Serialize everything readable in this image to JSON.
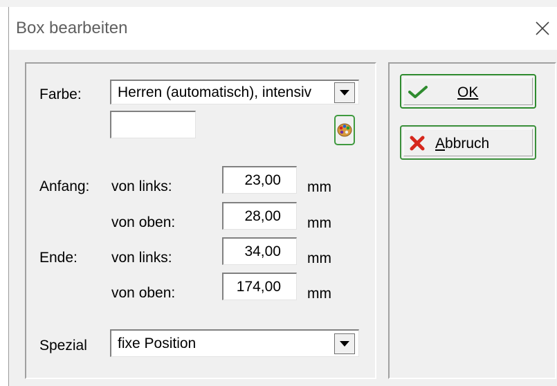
{
  "dialog": {
    "title": "Box bearbeiten",
    "close_icon": "close-icon"
  },
  "farbe": {
    "label": "Farbe:",
    "selected": "Herren (automatisch), intensiv",
    "color_field_value": "",
    "palette_icon": "palette-icon"
  },
  "anfang": {
    "label": "Anfang:",
    "left_label": "von links:",
    "left_value": "23,00",
    "left_unit": "mm",
    "top_label": "von oben:",
    "top_value": "28,00",
    "top_unit": "mm"
  },
  "ende": {
    "label": "Ende:",
    "left_label": "von links:",
    "left_value": "34,00",
    "left_unit": "mm",
    "top_label": "von oben:",
    "top_value": "174,00",
    "top_unit": "mm"
  },
  "spezial": {
    "label": "Spezial",
    "selected": "fixe Position"
  },
  "buttons": {
    "ok": {
      "label": "OK",
      "icon": "checkmark-icon",
      "accent": "#2e8b2e"
    },
    "cancel": {
      "label": "Abbruch",
      "icon": "cross-icon",
      "accent": "#d6271c"
    }
  }
}
